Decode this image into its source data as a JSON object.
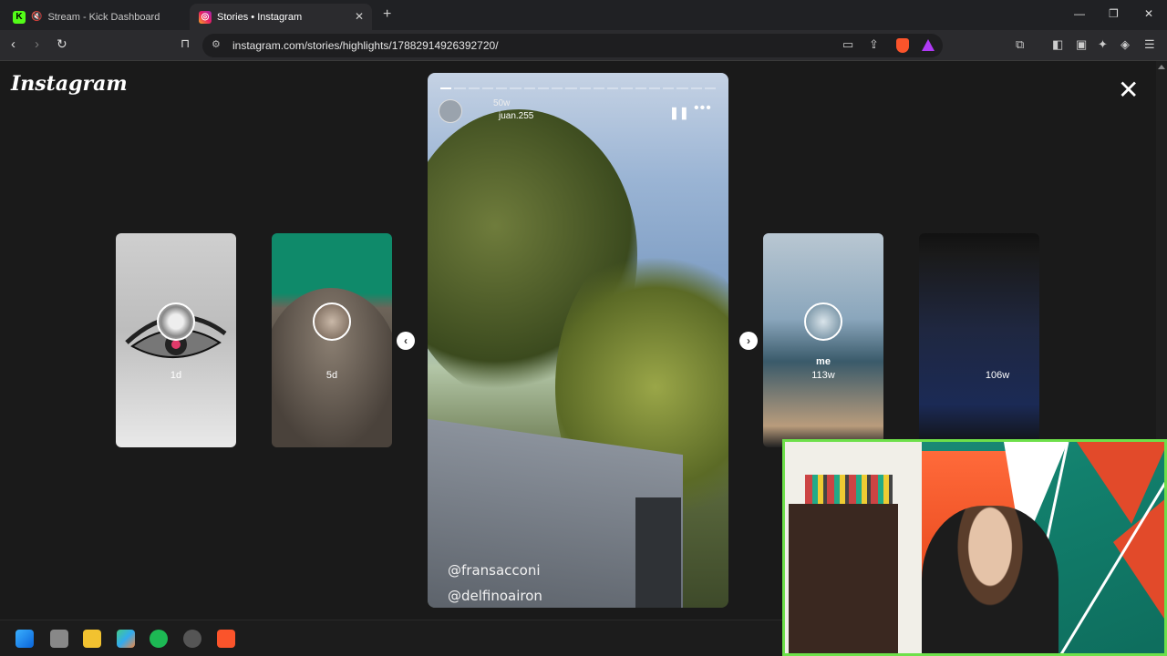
{
  "browser": {
    "tabs": [
      {
        "title": "Stream - Kick Dashboard",
        "favicon": "kick-icon"
      },
      {
        "title": "Stories • Instagram",
        "favicon": "instagram-icon",
        "active": true
      }
    ],
    "url": "instagram.com/stories/highlights/17882914926392720/"
  },
  "instagram": {
    "logo": "Instagram",
    "story": {
      "time": "50w",
      "username": "juan.255",
      "mentions": [
        "@fransacconi",
        "@delfinoairon"
      ]
    },
    "cards": [
      {
        "label": "1d"
      },
      {
        "label": "5d"
      },
      {
        "title": "me",
        "label": "113w"
      },
      {
        "label": "106w"
      }
    ]
  },
  "colors": {
    "accent_green": "#6ee04a",
    "kick_green": "#53fc18",
    "brave_orange": "#fb542b"
  }
}
